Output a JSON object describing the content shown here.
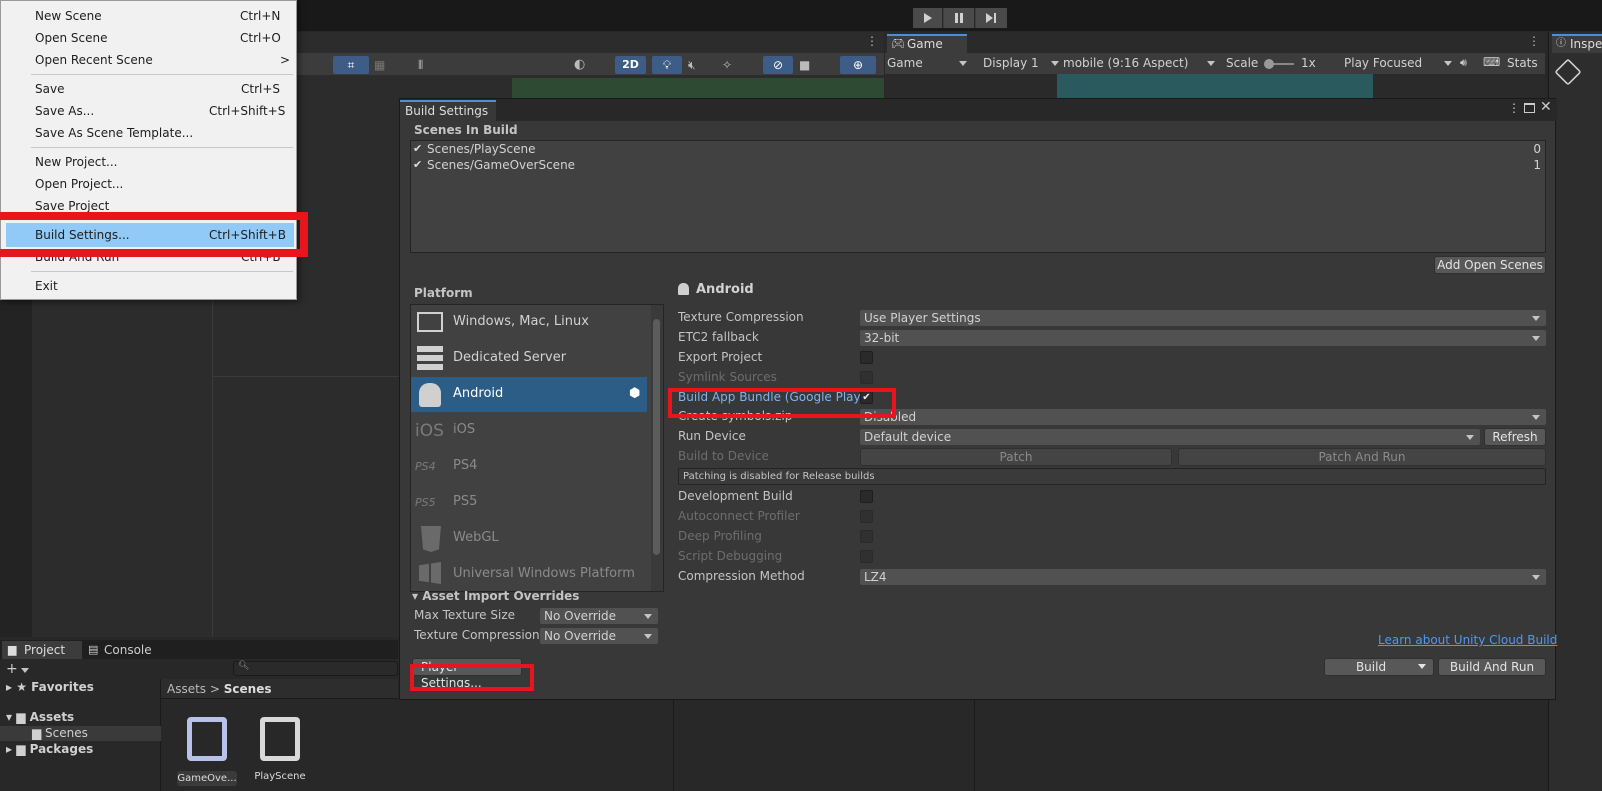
{
  "menu": {
    "items": [
      {
        "label": "New Scene",
        "shortcut": "Ctrl+N"
      },
      {
        "label": "Open Scene",
        "shortcut": "Ctrl+O"
      },
      {
        "label": "Open Recent Scene",
        "shortcut": ">"
      },
      {
        "label": "Save",
        "shortcut": "Ctrl+S"
      },
      {
        "label": "Save As...",
        "shortcut": "Ctrl+Shift+S"
      },
      {
        "label": "Save As Scene Template...",
        "shortcut": ""
      },
      {
        "label": "New Project...",
        "shortcut": ""
      },
      {
        "label": "Open Project...",
        "shortcut": ""
      },
      {
        "label": "Save Project",
        "shortcut": ""
      },
      {
        "label": "Build Settings...",
        "shortcut": "Ctrl+Shift+B"
      },
      {
        "label": "Build And Run",
        "shortcut": "Ctrl+B"
      },
      {
        "label": "Exit",
        "shortcut": ""
      }
    ]
  },
  "scene_toolbar": {
    "two_d": "2D"
  },
  "game_view": {
    "tab": "Game",
    "mode": "Game",
    "display": "Display 1",
    "aspect": "mobile (9:16 Aspect)",
    "scale_label": "Scale",
    "scale_value": "1x",
    "play_mode": "Play Focused",
    "stats": "Stats"
  },
  "inspector": {
    "tab": "Inspe"
  },
  "build_settings": {
    "title": "Build Settings",
    "scenes_header": "Scenes In Build",
    "scenes": [
      {
        "name": "Scenes/PlayScene",
        "index": "0"
      },
      {
        "name": "Scenes/GameOverScene",
        "index": "1"
      }
    ],
    "add_open_scenes": "Add Open Scenes",
    "platform_header": "Platform",
    "platforms": [
      {
        "name": "Windows, Mac, Linux",
        "icon": "monitor-icon"
      },
      {
        "name": "Dedicated Server",
        "icon": "server-icon"
      },
      {
        "name": "Android",
        "icon": "android-icon"
      },
      {
        "name": "iOS",
        "icon": "ios-icon",
        "badge": "iOS"
      },
      {
        "name": "PS4",
        "icon": "ps4-icon",
        "badge": "PS4"
      },
      {
        "name": "PS5",
        "icon": "ps5-icon",
        "badge": "PS5"
      },
      {
        "name": "WebGL",
        "icon": "html5-icon"
      },
      {
        "name": "Universal Windows Platform",
        "icon": "windows-icon"
      }
    ],
    "selected_platform": "Android",
    "settings": {
      "texture_compression_label": "Texture Compression",
      "texture_compression_value": "Use Player Settings",
      "etc2_label": "ETC2 fallback",
      "etc2_value": "32-bit",
      "export_project": "Export Project",
      "symlink_sources": "Symlink Sources",
      "build_app_bundle": "Build App Bundle (Google Play)",
      "create_symbols_label": "Create symbols.zip",
      "create_symbols_value": "Disabled",
      "run_device_label": "Run Device",
      "run_device_value": "Default device",
      "refresh": "Refresh",
      "build_to_device": "Build to Device",
      "patch": "Patch",
      "patch_and_run": "Patch And Run",
      "patching_note": "Patching is disabled for Release builds",
      "development_build": "Development Build",
      "autoconnect_profiler": "Autoconnect Profiler",
      "deep_profiling": "Deep Profiling",
      "script_debugging": "Script Debugging",
      "compression_label": "Compression Method",
      "compression_value": "LZ4"
    },
    "asset_import": {
      "header": "Asset Import Overrides",
      "max_texture_label": "Max Texture Size",
      "max_texture_value": "No Override",
      "texture_compression_label": "Texture Compression",
      "texture_compression_value": "No Override"
    },
    "player_settings": "Player Settings...",
    "cloud_build_link": "Learn about Unity Cloud Build",
    "build": "Build",
    "build_and_run": "Build And Run"
  },
  "project": {
    "tab_project": "Project",
    "tab_console": "Console",
    "favorites": "Favorites",
    "assets": "Assets",
    "scenes_folder": "Scenes",
    "packages": "Packages",
    "breadcrumb_root": "Assets",
    "breadcrumb_current": "Scenes",
    "files": [
      "GameOve...",
      "PlayScene"
    ]
  },
  "colors": {
    "accent_selected": "#2c5d87",
    "highlight": "#e8151f",
    "menu_selected": "#91c9f7",
    "link": "#4c9bf0"
  }
}
